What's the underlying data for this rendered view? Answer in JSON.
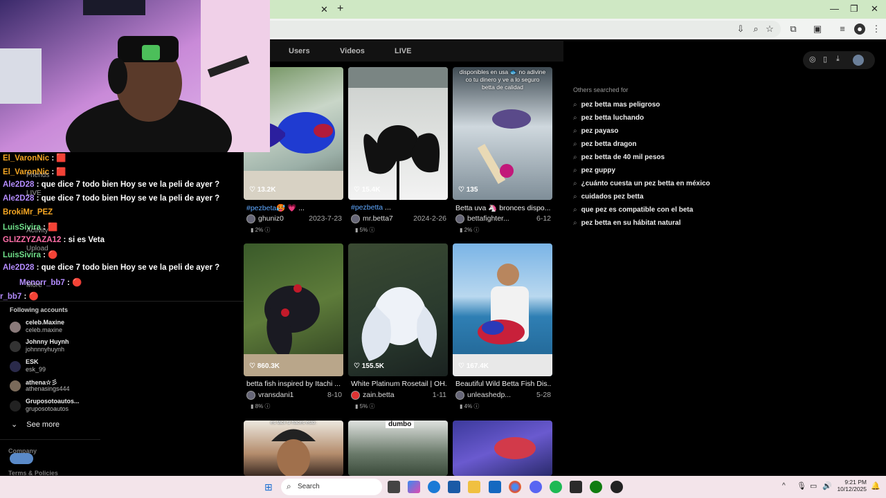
{
  "browser": {
    "tab_close_glyph": "✕",
    "new_tab_glyph": "+",
    "window_controls": [
      "—",
      "❐",
      "✕"
    ]
  },
  "tiktok": {
    "tabs": [
      "Users",
      "Videos",
      "LIVE"
    ],
    "videos": [
      {
        "likes": "13.2K",
        "caption_tag": "#pezbeta",
        "caption": "🥵 💗 ...",
        "user": "ghuniz0",
        "date": "2023-7-23",
        "stat": "2%"
      },
      {
        "likes": "15.4K",
        "caption_tag": "#pezbetta",
        "caption": " ...",
        "user": "mr.betta7",
        "date": "2024-2-26",
        "stat": "5%"
      },
      {
        "likes": "135",
        "caption_tag": "",
        "caption": "Betta uva 🦄 bronces dispo...",
        "user": "bettafighter...",
        "date": "6-12",
        "stat": "2%",
        "overlay": "disponibles en usa 🐟 no adivine co tu dinero y ve a lo seguro betta de calidad"
      },
      {
        "likes": "860.3K",
        "caption_tag": "",
        "caption": "betta fish inspired by Itachi ...",
        "user": "vransdani1",
        "date": "8-10",
        "stat": "8%"
      },
      {
        "likes": "155.5K",
        "caption_tag": "",
        "caption": "White Platinum Rosetail | OH...",
        "user": "zain.betta",
        "date": "1-11",
        "stat": "5%"
      },
      {
        "likes": "167.4K",
        "caption_tag": "",
        "caption": "Beautiful Wild Betta Fish Dis...",
        "user": "unleashedp...",
        "date": "5-28",
        "stat": "4%"
      }
    ],
    "bottom_overlay": [
      "es fácil si haces esto:",
      "dumbo"
    ],
    "others_title": "Others searched for",
    "suggestions": [
      "pez betta mas peligroso",
      "pez betta luchando",
      "pez payaso",
      "pez betta dragon",
      "pez betta de 40 mil pesos",
      "pez guppy",
      "¿cuánto cuesta un pez betta en méxico",
      "cuidados pez betta",
      "que pez es compatible con el beta",
      "pez betta en su hábitat natural"
    ]
  },
  "chat": [
    {
      "user": "El_VaronNic",
      "text": ": 🟥",
      "color": "#f5a623"
    },
    {
      "user": "El_VaronNic",
      "text": ": 🟥",
      "color": "#f5a623"
    },
    {
      "user": "Ale2D28",
      "text": ": que dice 7 todo bien Hoy se ve la peli de ayer ?",
      "color": "#b48cff"
    },
    {
      "user": "Ale2D28",
      "text": ": que dice 7 todo bien Hoy se ve la peli de ayer ?",
      "color": "#b48cff"
    },
    {
      "user": "BrokiMr_PEZ",
      "text": "",
      "color": "#f5a623"
    },
    {
      "user": "LuisSivira",
      "text": ": 🟥",
      "color": "#6fe08a"
    },
    {
      "user": "GLIZZYZAZA12",
      "text": ": si es Veta",
      "color": "#ff6fa8"
    },
    {
      "user": "LuisSivira",
      "text": ": 🔴",
      "color": "#6fe08a"
    },
    {
      "user": "Ale2D28",
      "text": ": que dice 7 todo bien Hoy se ve la peli de ayer ?",
      "color": "#b48cff"
    },
    {
      "user": "Menorr_bb7",
      "text": ": 🔴",
      "color": "#b48cff"
    },
    {
      "user": "r_bb7",
      "text": ": 🔴",
      "color": "#b48cff"
    }
  ],
  "nav_ghost": [
    "Friends",
    "LIVE",
    "Activity",
    "Upload",
    "More"
  ],
  "following": {
    "title": "Following accounts",
    "accounts": [
      {
        "name": "celeb.Maxine",
        "handle": "celeb.maxine"
      },
      {
        "name": "Johnny Huynh",
        "handle": "johnnnyhuynh"
      },
      {
        "name": "ESK",
        "handle": "esk_99"
      },
      {
        "name": "athena☆彡",
        "handle": "athenasings444"
      },
      {
        "name": "Gruposotoautos...",
        "handle": "gruposotoautos"
      }
    ],
    "see_more": "See more",
    "company": "Company",
    "terms": "Terms & Policies"
  },
  "taskbar": {
    "search_label": "Search",
    "time": "9:21 PM",
    "date": "10/12/2025"
  }
}
